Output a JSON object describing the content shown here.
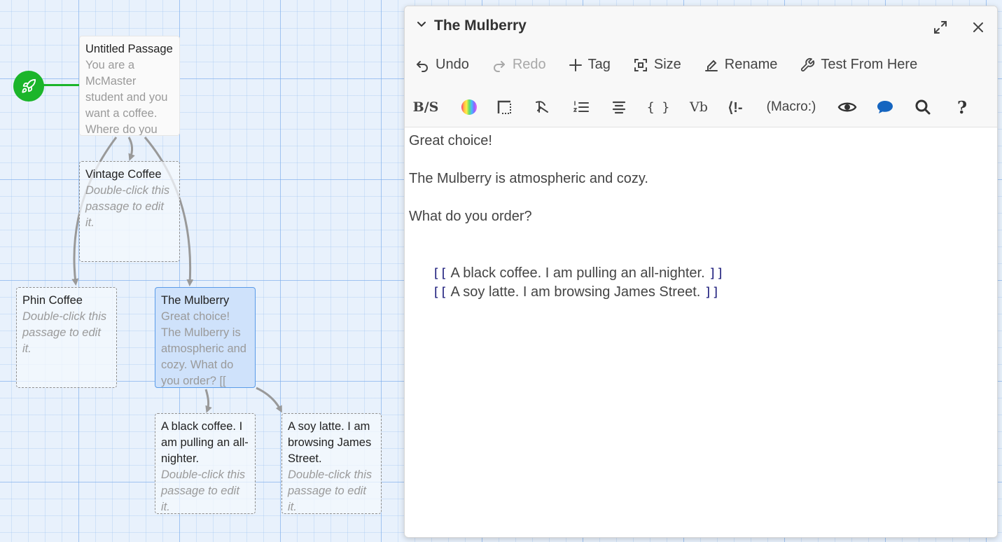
{
  "story_map": {
    "start_icon": "rocket-icon",
    "passages": [
      {
        "id": "untitled",
        "title": "Untitled Passage",
        "excerpt": "You are a McMaster student and you want a coffee. Where do you",
        "placeholder": false
      },
      {
        "id": "vintage",
        "title": "Vintage Coffee",
        "excerpt": "Double-click this passage to edit it.",
        "placeholder": true
      },
      {
        "id": "phin",
        "title": "Phin Coffee",
        "excerpt": "Double-click this passage to edit it.",
        "placeholder": true
      },
      {
        "id": "mulberry",
        "title": "The Mulberry",
        "excerpt": "Great choice! The Mulberry is atmospheric and cozy. What do you order? [[",
        "placeholder": false,
        "selected": true
      },
      {
        "id": "black",
        "title": "A black coffee. I am pulling an all-nighter.",
        "excerpt": "Double-click this passage to edit it.",
        "placeholder": true
      },
      {
        "id": "soy",
        "title": "A soy latte. I am browsing James Street.",
        "excerpt": "Double-click this passage to edit it.",
        "placeholder": true
      }
    ]
  },
  "dialog": {
    "title": "The Mulberry",
    "toolbar": {
      "undo": "Undo",
      "redo": "Redo",
      "tag": "Tag",
      "size": "Size",
      "rename": "Rename",
      "test": "Test From Here"
    },
    "format_toolbar": {
      "bold_strike": "B/S",
      "vb": "Vb",
      "comment": "⟨!-",
      "macro": "(Macro:)",
      "help": "?",
      "braces": "{ }"
    },
    "editor": {
      "lines": [
        "Great choice!",
        "",
        "The Mulberry is atmospheric and cozy.",
        "",
        "What do you order?",
        ""
      ],
      "links": [
        {
          "open": "[[",
          "text": " A black coffee. I am pulling an all-nighter. ",
          "close": "]]"
        },
        {
          "open": "[[",
          "text": " A soy latte. I am browsing James Street. ",
          "close": "]]"
        }
      ]
    }
  },
  "colors": {
    "start": "#1bb52a",
    "selected": "#cfe2fb",
    "accent": "#1565c0"
  }
}
